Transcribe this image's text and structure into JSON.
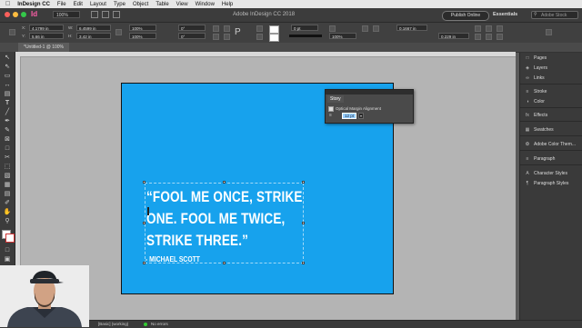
{
  "menubar": {
    "app_name": "InDesign CC",
    "items": [
      "File",
      "Edit",
      "Layout",
      "Type",
      "Object",
      "Table",
      "View",
      "Window",
      "Help"
    ]
  },
  "appbar": {
    "title": "Adobe InDesign CC 2018",
    "zoom": "100%",
    "publish_label": "Publish Online",
    "workspace": "Essentials",
    "search_placeholder": "Adobe Stock"
  },
  "control": {
    "x": "4.1799 in",
    "y": "5.66 in",
    "w": "6.4599 in",
    "h": "3.42 in",
    "scale_x": "100%",
    "scale_y": "100%",
    "rotate": "0°",
    "shear": "0°",
    "stroke": "0 pt",
    "opacity": "100%",
    "inset": "0.1667 in",
    "inset2": "0.229 in"
  },
  "document_tab": "*Untitled-1 @ 100%",
  "artwork": {
    "quote_lines": [
      "“FOOL ME ONCE, STRIKE",
      "ONE. FOOL ME TWICE,",
      "STRIKE THREE.”"
    ],
    "author": "- MICHAEL SCOTT",
    "page_color": "#17a2ed"
  },
  "story_panel": {
    "tab": "Story",
    "option_label": "Optical Margin Alignment",
    "size_value": "12 pt"
  },
  "panels": [
    {
      "icon": "pages-icon",
      "label": "Pages"
    },
    {
      "icon": "layers-icon",
      "label": "Layers"
    },
    {
      "icon": "links-icon",
      "label": "Links"
    },
    {
      "icon": "stroke-icon",
      "label": "Stroke"
    },
    {
      "icon": "color-icon",
      "label": "Color"
    },
    {
      "icon": "effects-icon",
      "label": "Effects"
    },
    {
      "icon": "swatches-icon",
      "label": "Swatches"
    },
    {
      "icon": "color-theme-icon",
      "label": "Adobe Color Them..."
    },
    {
      "icon": "paragraph-icon",
      "label": "Paragraph"
    },
    {
      "icon": "character-styles-icon",
      "label": "Character Styles"
    },
    {
      "icon": "paragraph-styles-icon",
      "label": "Paragraph Styles"
    }
  ],
  "status": {
    "preflight_profile": "[Basic] (working)",
    "errors": "No errors"
  }
}
